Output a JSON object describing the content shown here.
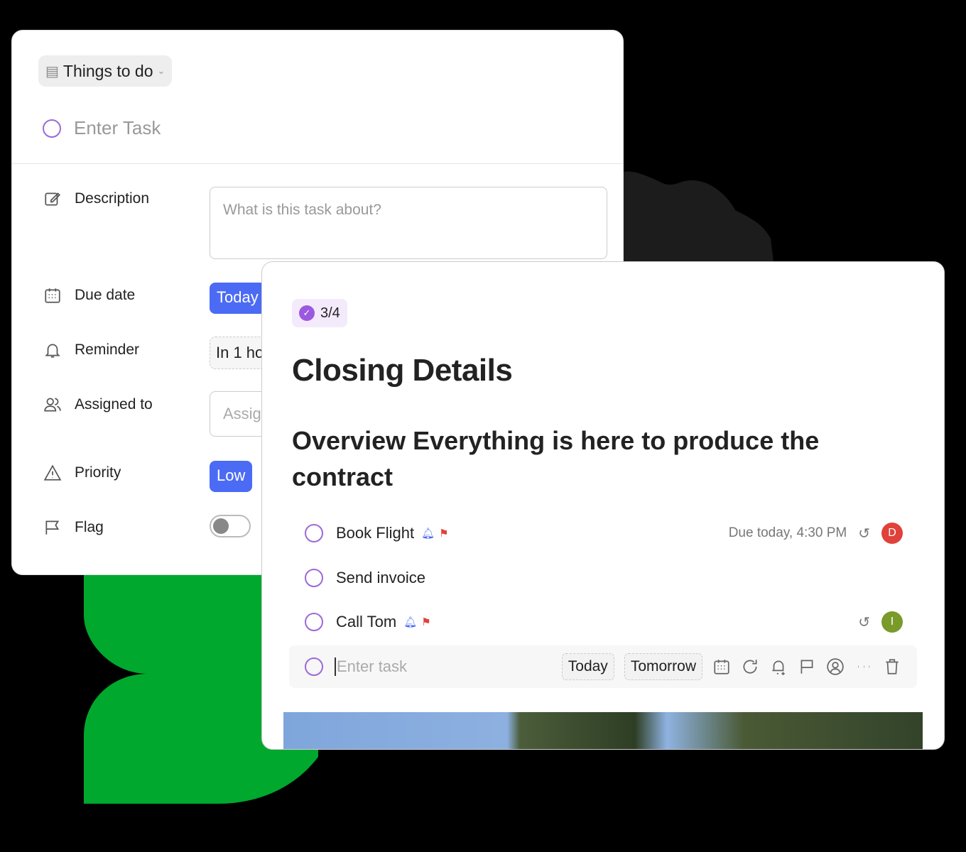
{
  "task_form": {
    "list_name": "Things to do",
    "task_placeholder": "Enter Task",
    "fields": [
      {
        "label": "Description",
        "placeholder": "What is this task about?"
      },
      {
        "label": "Due date",
        "value": "Today"
      },
      {
        "label": "Reminder",
        "value": "In 1 ho"
      },
      {
        "label": "Assigned to",
        "placeholder": "Assig"
      },
      {
        "label": "Priority",
        "value": "Low"
      },
      {
        "label": "Flag",
        "toggle_on": false
      }
    ]
  },
  "detail": {
    "progress": "3/4",
    "title": "Closing Details",
    "overview": "Overview Everything is here to produce the contract",
    "tasks": [
      {
        "name": "Book Flight",
        "reminder": true,
        "flag": true,
        "due": "Due today, 4:30 PM",
        "repeat": true,
        "assignee": "D",
        "assignee_color": "#e0413a"
      },
      {
        "name": "Send invoice"
      },
      {
        "name": "Call Tom",
        "reminder": true,
        "flag": true,
        "repeat": true,
        "assignee": "I",
        "assignee_color": "#7a9a2a"
      }
    ],
    "new_task": {
      "placeholder": "Enter task",
      "chips": [
        "Today",
        "Tomorrow"
      ]
    }
  },
  "colors": {
    "accent": "#4b6bf5",
    "circle": "#9b6ad8",
    "green": "#00a82d",
    "flag": "#e0413a"
  }
}
